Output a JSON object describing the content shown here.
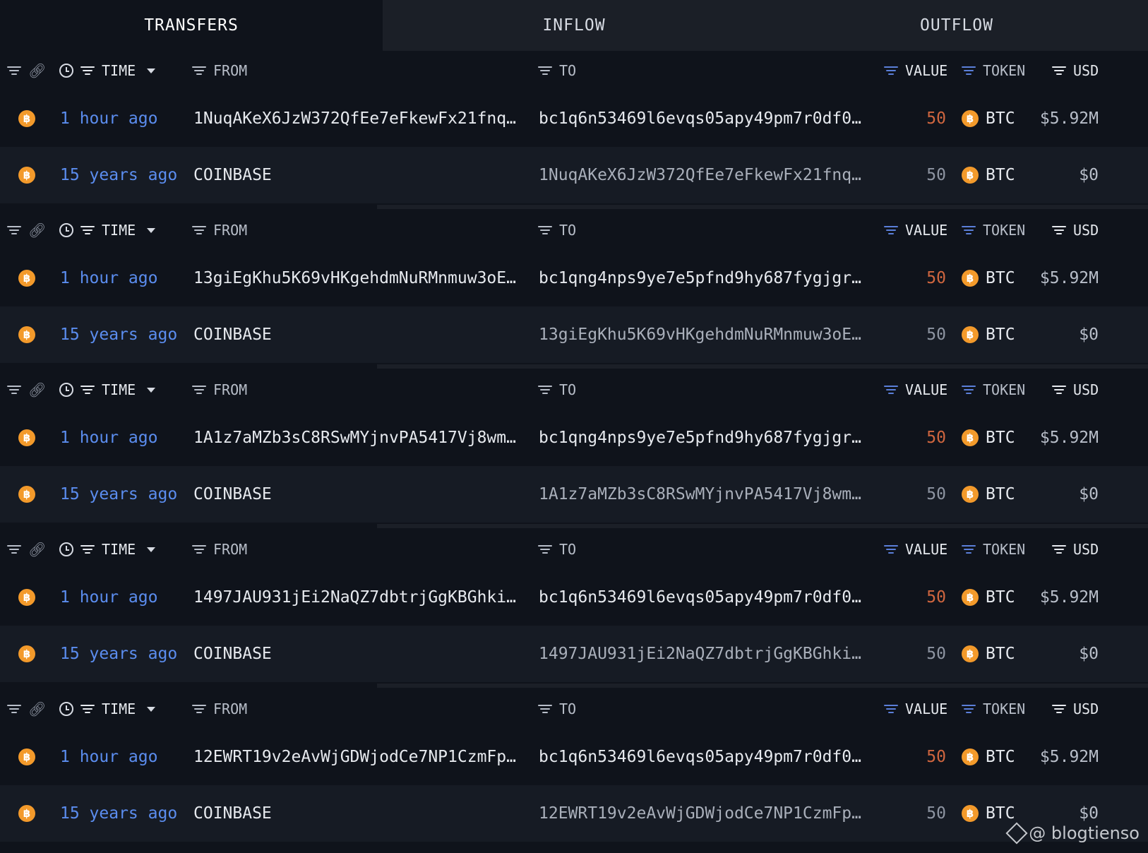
{
  "tabs": [
    {
      "label": "TRANSFERS",
      "active": true
    },
    {
      "label": "INFLOW",
      "active": false
    },
    {
      "label": "OUTFLOW",
      "active": false
    }
  ],
  "columns": {
    "time": "TIME",
    "from": "FROM",
    "to": "TO",
    "value": "VALUE",
    "token": "TOKEN",
    "usd": "USD"
  },
  "blocks": [
    {
      "rows": [
        {
          "time": "1 hour ago",
          "from": "1NuqAKeX6JzW372QfEe7eFkewFx21fnq…",
          "to": "bc1q6n53469l6evqs05apy49pm7r0df0…",
          "value": "50",
          "token": "BTC",
          "usd": "$5.92M"
        },
        {
          "time": "15 years ago",
          "from": "COINBASE",
          "to": "1NuqAKeX6JzW372QfEe7eFkewFx21fnq…",
          "value": "50",
          "token": "BTC",
          "usd": "$0"
        }
      ]
    },
    {
      "rows": [
        {
          "time": "1 hour ago",
          "from": "13giEgKhu5K69vHKgehdmNuRMnmuw3oE…",
          "to": "bc1qng4nps9ye7e5pfnd9hy687fygjgr…",
          "value": "50",
          "token": "BTC",
          "usd": "$5.92M"
        },
        {
          "time": "15 years ago",
          "from": "COINBASE",
          "to": "13giEgKhu5K69vHKgehdmNuRMnmuw3oE…",
          "value": "50",
          "token": "BTC",
          "usd": "$0"
        }
      ]
    },
    {
      "rows": [
        {
          "time": "1 hour ago",
          "from": "1A1z7aMZb3sC8RSwMYjnvPA5417Vj8wm…",
          "to": "bc1qng4nps9ye7e5pfnd9hy687fygjgr…",
          "value": "50",
          "token": "BTC",
          "usd": "$5.92M"
        },
        {
          "time": "15 years ago",
          "from": "COINBASE",
          "to": "1A1z7aMZb3sC8RSwMYjnvPA5417Vj8wm…",
          "value": "50",
          "token": "BTC",
          "usd": "$0"
        }
      ]
    },
    {
      "rows": [
        {
          "time": "1 hour ago",
          "from": "1497JAU931jEi2NaQZ7dbtrjGgKBGhki…",
          "to": "bc1q6n53469l6evqs05apy49pm7r0df0…",
          "value": "50",
          "token": "BTC",
          "usd": "$5.92M"
        },
        {
          "time": "15 years ago",
          "from": "COINBASE",
          "to": "1497JAU931jEi2NaQZ7dbtrjGgKBGhki…",
          "value": "50",
          "token": "BTC",
          "usd": "$0"
        }
      ]
    },
    {
      "rows": [
        {
          "time": "1 hour ago",
          "from": "12EWRT19v2eAvWjGDWjodCe7NP1CzmFp…",
          "to": "bc1q6n53469l6evqs05apy49pm7r0df0…",
          "value": "50",
          "token": "BTC",
          "usd": "$5.92M"
        },
        {
          "time": "15 years ago",
          "from": "COINBASE",
          "to": "12EWRT19v2eAvWjGDWjodCe7NP1CzmFp…",
          "value": "50",
          "token": "BTC",
          "usd": "$0"
        }
      ]
    }
  ],
  "token_icon": "bitcoin-icon",
  "colors": {
    "background": "#0f131b",
    "time_link": "#5b8def",
    "value_highlight": "#d0663f",
    "btc_orange": "#f39a2b"
  },
  "watermark": "@ blogtienso"
}
